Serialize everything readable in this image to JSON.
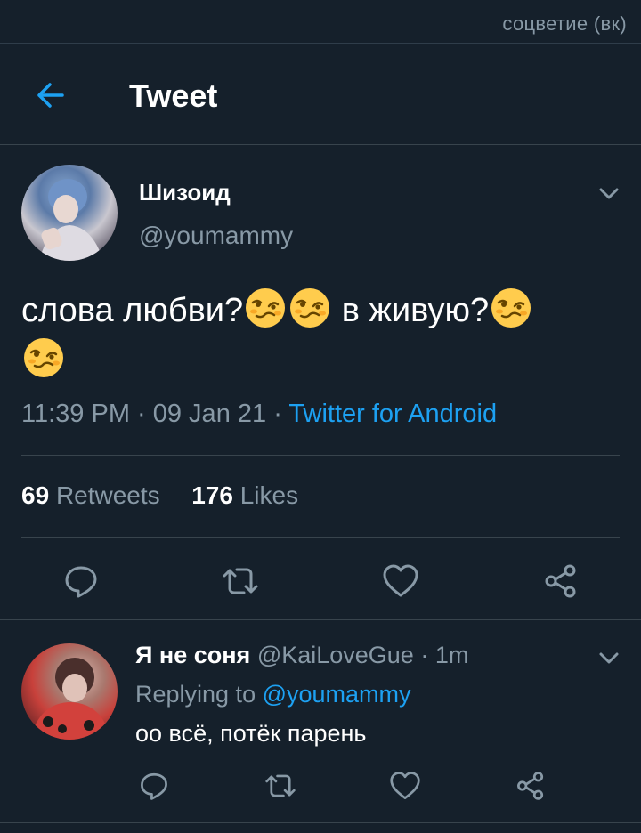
{
  "watermark": "соцветие (вк)",
  "header": {
    "title": "Tweet",
    "back_icon": "arrow-left-icon"
  },
  "tweet": {
    "author_name": "Шизоид",
    "author_handle": "@youmammy",
    "text_part1": "слова любви?",
    "text_part2": " в живую?",
    "emoji": "woozy-face-icon",
    "time": "11:39 PM · 09 Jan 21 · ",
    "source": "Twitter for Android",
    "retweets_count": "69",
    "retweets_label": "Retweets",
    "likes_count": "176",
    "likes_label": "Likes"
  },
  "reply": {
    "name": "Я не соня",
    "meta": " @KaiLoveGue · 1m",
    "replying_prefix": "Replying to ",
    "replying_handle": "@youmammy",
    "text": "оо всё, потёк парень"
  },
  "colors": {
    "background": "#15202b",
    "accent": "#1da1f2",
    "muted": "#8899a6",
    "divider": "#38444d"
  }
}
